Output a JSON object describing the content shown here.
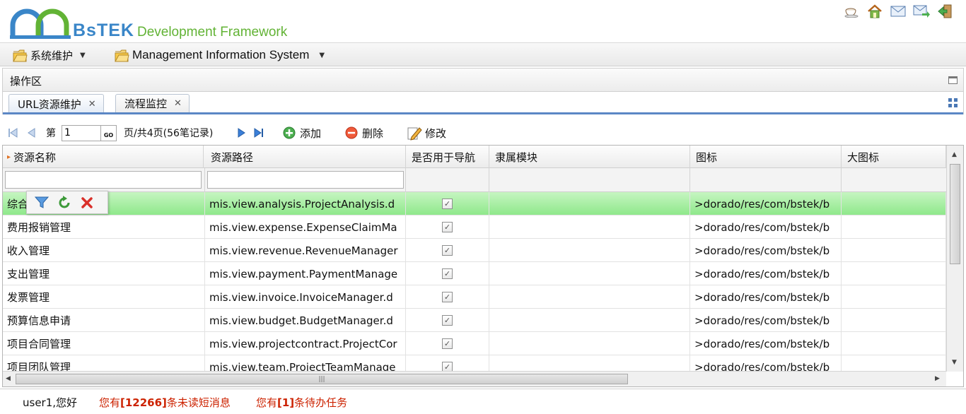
{
  "header": {
    "brand": "BsTEK",
    "subtitle": "Development Framework",
    "tools": [
      {
        "icon": "coffee-cup-icon"
      },
      {
        "icon": "home-icon"
      },
      {
        "icon": "mail-icon"
      },
      {
        "icon": "mail-forward-icon"
      },
      {
        "icon": "exit-icon"
      }
    ]
  },
  "menu": {
    "items": [
      {
        "label": "系统维护",
        "icon": "folder-icon"
      },
      {
        "label": "Management Information System",
        "icon": "folder-icon"
      }
    ]
  },
  "panel": {
    "title": "操作区"
  },
  "tabs": [
    {
      "label": "URL资源维护",
      "active": true
    },
    {
      "label": "流程监控",
      "active": false
    }
  ],
  "toolbar": {
    "page_prefix": "第",
    "page_value": "1",
    "go_label": "GO",
    "page_suffix": "页/共4页(56笔记录)",
    "add_label": "添加",
    "delete_label": "删除",
    "edit_label": "修改"
  },
  "grid": {
    "columns": [
      "资源名称",
      "资源路径",
      "是否用于导航",
      "隶属模块",
      "图标",
      "大图标"
    ],
    "rows": [
      {
        "name": "综合",
        "path": "mis.view.analysis.ProjectAnalysis.d",
        "nav": true,
        "module": "",
        "icon": ">dorado/res/com/bstek/b",
        "big_icon": ""
      },
      {
        "name": "费用报销管理",
        "path": "mis.view.expense.ExpenseClaimMa",
        "nav": true,
        "module": "",
        "icon": ">dorado/res/com/bstek/b",
        "big_icon": ""
      },
      {
        "name": "收入管理",
        "path": "mis.view.revenue.RevenueManager",
        "nav": true,
        "module": "",
        "icon": ">dorado/res/com/bstek/b",
        "big_icon": ""
      },
      {
        "name": "支出管理",
        "path": "mis.view.payment.PaymentManage",
        "nav": true,
        "module": "",
        "icon": ">dorado/res/com/bstek/b",
        "big_icon": ""
      },
      {
        "name": "发票管理",
        "path": "mis.view.invoice.InvoiceManager.d",
        "nav": true,
        "module": "",
        "icon": ">dorado/res/com/bstek/b",
        "big_icon": ""
      },
      {
        "name": "预算信息申请",
        "path": "mis.view.budget.BudgetManager.d",
        "nav": true,
        "module": "",
        "icon": ">dorado/res/com/bstek/b",
        "big_icon": ""
      },
      {
        "name": "项目合同管理",
        "path": "mis.view.projectcontract.ProjectCor",
        "nav": true,
        "module": "",
        "icon": ">dorado/res/com/bstek/b",
        "big_icon": ""
      },
      {
        "name": "项目团队管理",
        "path": "mis.view.team.ProjectTeamManage",
        "nav": true,
        "module": "",
        "icon": ">dorado/res/com/bstek/b",
        "big_icon": ""
      }
    ]
  },
  "status": {
    "user": "user1,您好",
    "messages_prefix": "您有",
    "messages_count": "[12266]",
    "messages_suffix": "条未读短消息",
    "tasks_prefix": "您有",
    "tasks_count": "[1]",
    "tasks_suffix": "条待办任务"
  },
  "colors": {
    "accent": "#5b87c5",
    "selected_row": "#8fe88b",
    "alert": "#cc2200",
    "brand_blue": "#3a86c8",
    "brand_green": "#62b335"
  }
}
